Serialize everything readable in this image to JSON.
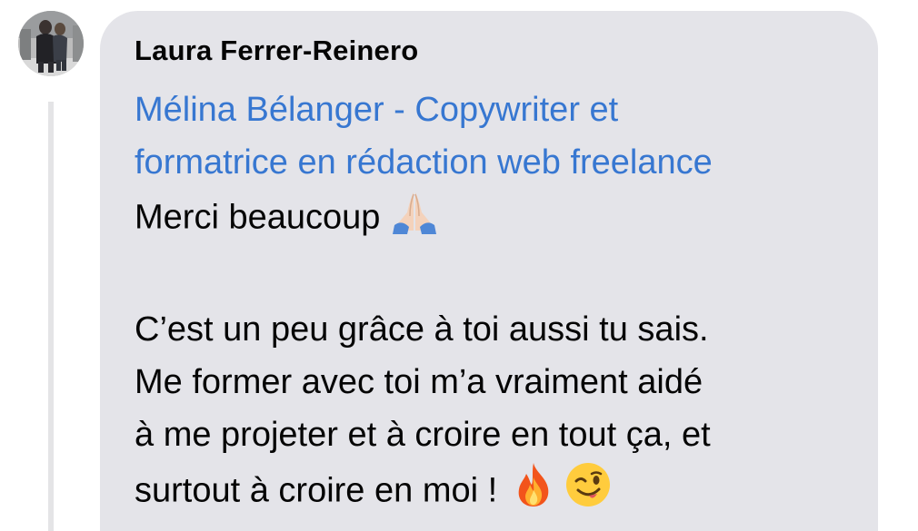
{
  "comment": {
    "author": "Laura Ferrer-Reinero",
    "mention_line1": "Mélina Bélanger - Copywriter et",
    "mention_line2": "formatrice en rédaction web freelance",
    "line1": "Merci beaucoup",
    "para2_line1": "C’est un peu grâce à toi aussi tu sais.",
    "para2_line2": "Me former avec toi m’a vraiment aidé",
    "para2_line3": "à me projeter et à croire en tout ça, et",
    "para2_line4": "surtout à croire en moi !",
    "icons": [
      "avatar-photo",
      "folded-hands-emoji",
      "fire-emoji",
      "winking-face-emoji"
    ]
  },
  "colors": {
    "bubble": "#e4e4e9",
    "mention": "#3777d1",
    "text": "#050505",
    "thread_line": "#e4e4e6"
  }
}
